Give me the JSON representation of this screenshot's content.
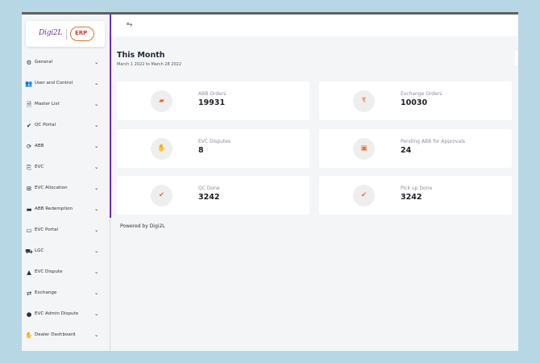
{
  "brand": {
    "logo_text": "Digi2L",
    "erp_badge": "ERP"
  },
  "sidebar": {
    "items": [
      {
        "label": "General",
        "icon": "gear-icon",
        "glyph": "⚙"
      },
      {
        "label": "User and Control",
        "icon": "user-cog-icon",
        "glyph": "👥"
      },
      {
        "label": "Master List",
        "icon": "document-icon",
        "glyph": "🗎"
      },
      {
        "label": "QC Portal",
        "icon": "clipboard-check-icon",
        "glyph": "✔"
      },
      {
        "label": "ABB",
        "icon": "sync-icon",
        "glyph": "⟳"
      },
      {
        "label": "EVC",
        "icon": "file-export-icon",
        "glyph": "⎘"
      },
      {
        "label": "EVC Allocation",
        "icon": "square-plus-icon",
        "glyph": "⊞"
      },
      {
        "label": "ABB Redemption",
        "icon": "card-icon",
        "glyph": "▬"
      },
      {
        "label": "EVC Portal",
        "icon": "laptop-icon",
        "glyph": "▭"
      },
      {
        "label": "LGC",
        "icon": "truck-icon",
        "glyph": "⛟"
      },
      {
        "label": "EVC Dispute",
        "icon": "warning-icon",
        "glyph": "▲"
      },
      {
        "label": "Exchange",
        "icon": "exchange-icon",
        "glyph": "⇄"
      },
      {
        "label": "EVC Admin Dispute",
        "icon": "alert-circle-icon",
        "glyph": "●"
      },
      {
        "label": "Dealer Dashboard",
        "icon": "handshake-icon",
        "glyph": "✋"
      }
    ],
    "chevron": "⌄"
  },
  "header": {
    "menu_icon": "⥱"
  },
  "main": {
    "title": "This Month",
    "subtitle": "March 1 2022 to March 28 2022",
    "cards": [
      {
        "label": "ABB Orders",
        "value": "19931",
        "icon": "wallet-icon",
        "glyph": "▰"
      },
      {
        "label": "Exchange Orders",
        "value": "10030",
        "icon": "rupee-icon",
        "glyph": "₹"
      },
      {
        "label": "EVC Disputes",
        "value": "8",
        "icon": "hand-money-icon",
        "glyph": "✋"
      },
      {
        "label": "Pending ABB for Approvals",
        "value": "24",
        "icon": "briefcase-icon",
        "glyph": "▣"
      },
      {
        "label": "QC Done",
        "value": "3242",
        "icon": "clipboard-check-icon",
        "glyph": "✔"
      },
      {
        "label": "Pick up Done",
        "value": "3242",
        "icon": "clipboard-check-icon",
        "glyph": "✔"
      }
    ]
  },
  "footer": {
    "powered_by": "Powered by Digi2L"
  },
  "colors": {
    "accent": "#6a2ec3",
    "icon_orange": "#f06a24",
    "background": "#b8d7e5"
  }
}
